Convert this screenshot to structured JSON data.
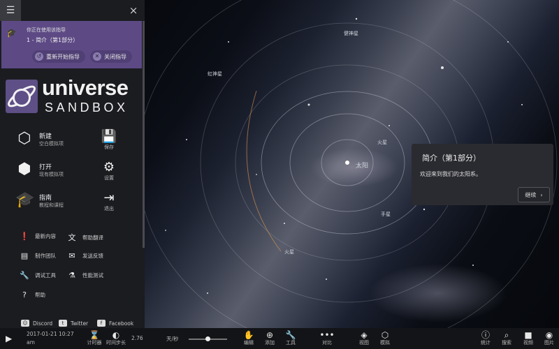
{
  "topbar": {
    "menu_icon": "hamburger-icon",
    "close_label": "×"
  },
  "guide": {
    "status_text": "你正在使用该指导",
    "current": "1 - 简介（第1部分）",
    "restart_label": "重新开始指导",
    "close_label": "关闭指导",
    "accent_color": "#5d4a85"
  },
  "logo": {
    "word1": "universe",
    "word2": "SANDBOX"
  },
  "main_menu": [
    {
      "icon": "cube-icon",
      "label": "新建",
      "sub": "空白模拟项"
    },
    {
      "icon": "open-cube-icon",
      "label": "打开",
      "sub": "现有模拟项"
    },
    {
      "icon": "graduation-cap-icon",
      "label": "指南",
      "sub": "教程和课程"
    }
  ],
  "side_menu": [
    {
      "icon": "save-icon",
      "label": "保存"
    },
    {
      "icon": "gear-icon",
      "label": "设置"
    },
    {
      "icon": "exit-icon",
      "label": "退出"
    }
  ],
  "small_menu": [
    {
      "icon": "alert-icon",
      "label": "最新内容"
    },
    {
      "icon": "translate-icon",
      "label": "帮助翻译"
    },
    {
      "icon": "credits-icon",
      "label": "制作团队"
    },
    {
      "icon": "feedback-icon",
      "label": "发送反馈"
    },
    {
      "icon": "wrench-icon",
      "label": "调试工具"
    },
    {
      "icon": "flask-icon",
      "label": "性能测试"
    },
    {
      "icon": "help-icon",
      "label": "帮助"
    }
  ],
  "social": [
    {
      "icon": "discord-icon",
      "label": "Discord"
    },
    {
      "icon": "twitter-icon",
      "label": "Twitter"
    },
    {
      "icon": "facebook-icon",
      "label": "Facebook"
    }
  ],
  "planets": {
    "jupiter": "健神星",
    "uranus": "虹神星",
    "venus": "火星",
    "sun": "太阳",
    "earth": "手星",
    "mars": "火星"
  },
  "popup": {
    "title": "简介（第1部分）",
    "body": "欢迎来到我们的太阳系。",
    "next_label": "继续"
  },
  "bottom": {
    "datetime_line1": "2017-01-21 10:27",
    "datetime_line2": "am",
    "timer_label": "计时器",
    "timestep_label": "时间步长",
    "timestep_value": "2.76",
    "speed_unit": "天/秒",
    "tools": [
      {
        "icon": "hand-icon",
        "label": "编辑"
      },
      {
        "icon": "plus-circle-icon",
        "label": "添加"
      },
      {
        "icon": "wrench-icon",
        "label": "工具"
      },
      {
        "icon": "compare-icon",
        "label": "对比"
      },
      {
        "icon": "layers-icon",
        "label": "视图"
      },
      {
        "icon": "cube-icon",
        "label": "模拟"
      }
    ],
    "right_tools": [
      {
        "icon": "info-icon",
        "label": "统计"
      },
      {
        "icon": "search-icon",
        "label": "搜索"
      },
      {
        "icon": "video-icon",
        "label": "视频"
      },
      {
        "icon": "camera-icon",
        "label": "图片"
      }
    ]
  }
}
